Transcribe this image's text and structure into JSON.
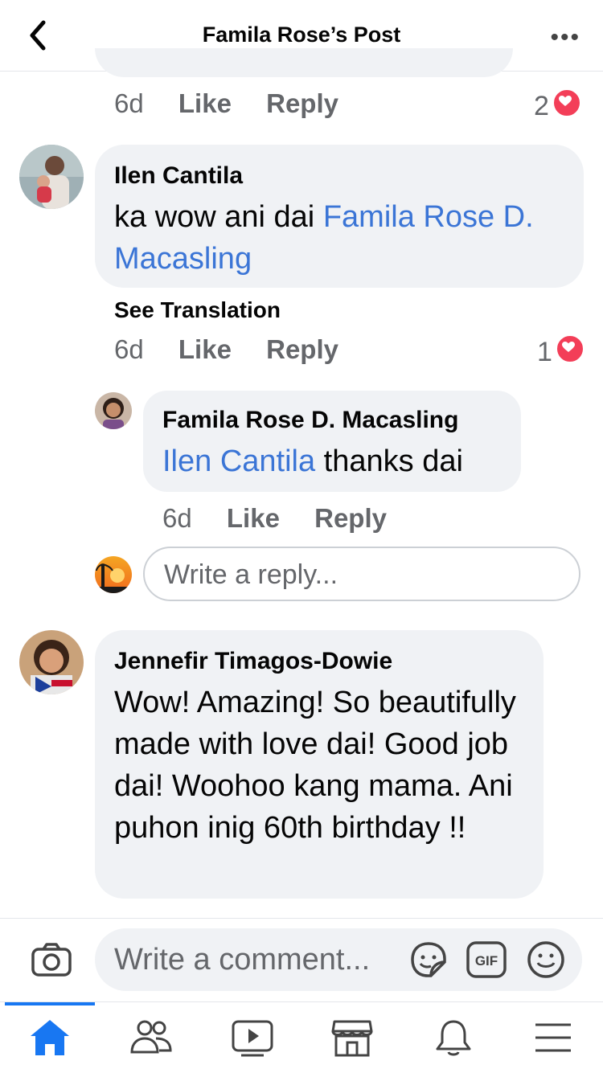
{
  "header": {
    "title": "Famila Rose’s Post"
  },
  "top_comment_meta": {
    "time": "6d",
    "like": "Like",
    "reply": "Reply",
    "reaction_count": "2"
  },
  "comments": [
    {
      "author": "Ilen Cantila",
      "text_before": "ka wow ani dai ",
      "mention": "Famila Rose D. Macasling",
      "see_translation": "See Translation",
      "time": "6d",
      "like": "Like",
      "reply": "Reply",
      "reaction_count": "1"
    },
    {
      "author": "Famila Rose D. Macasling",
      "mention": "Ilen Cantila",
      "text_after": " thanks dai",
      "time": "6d",
      "like": "Like",
      "reply": "Reply"
    },
    {
      "author": "Jennefir Timagos-Dowie",
      "text": "Wow! Amazing! So beautifully made with love dai! Good job dai! Woohoo kang mama. Ani puhon inig 60th birthday !!"
    }
  ],
  "reply_input": {
    "placeholder": "Write a reply..."
  },
  "composer": {
    "placeholder": "Write a comment..."
  },
  "icons": {
    "back": "chevron-left-icon",
    "more": "more-dots-icon",
    "camera": "camera-icon",
    "sticker": "sticker-icon",
    "gif": "gif-icon",
    "emoji": "emoji-icon",
    "home": "home-icon",
    "friends": "friends-icon",
    "watch": "watch-icon",
    "marketplace": "marketplace-icon",
    "notifications": "bell-icon",
    "menu": "menu-icon"
  },
  "colors": {
    "accent": "#1877f2",
    "link": "#3b75d6",
    "heart": "#f33e58",
    "bubble": "#f0f2f5",
    "meta": "#65676b"
  }
}
